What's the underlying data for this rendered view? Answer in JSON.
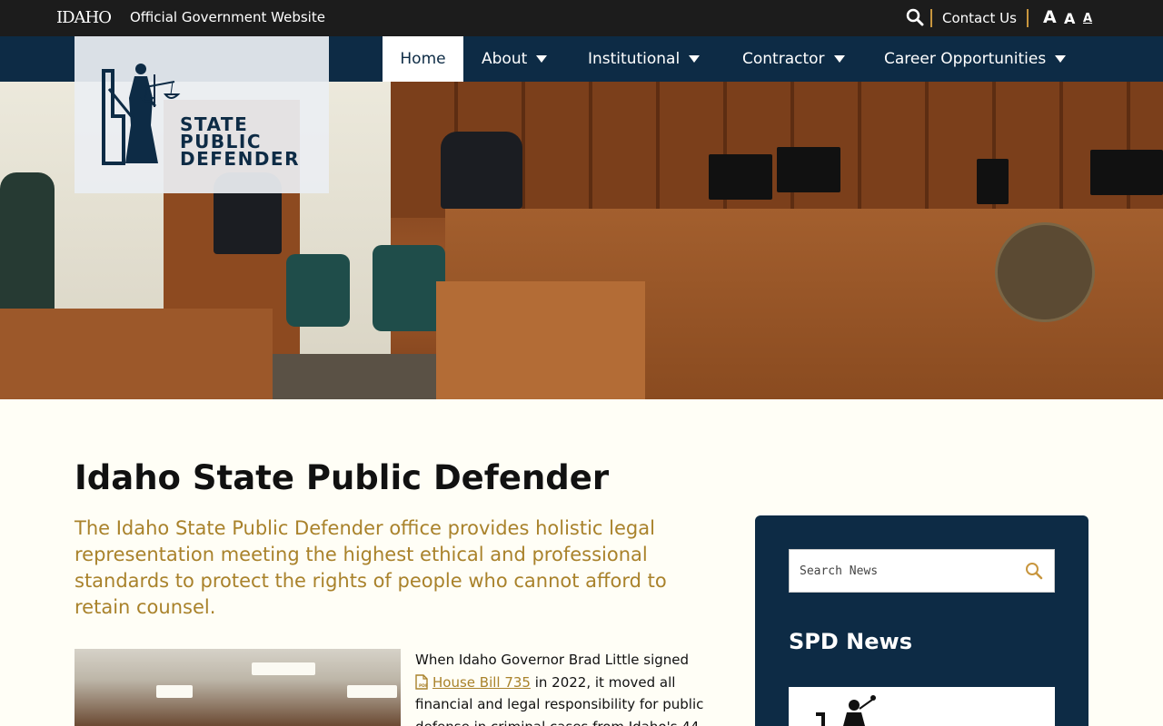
{
  "topbar": {
    "state_logo": "IDAHO",
    "official_label": "Official Government Website",
    "contact_label": "Contact Us",
    "font_sizes": [
      "A",
      "A",
      "A"
    ]
  },
  "nav": {
    "items": [
      {
        "label": "Home",
        "active": true
      },
      {
        "label": "About",
        "dropdown": true
      },
      {
        "label": "Institutional",
        "dropdown": true
      },
      {
        "label": "Contractor",
        "dropdown": true
      },
      {
        "label": "Career Opportunities",
        "dropdown": true
      }
    ]
  },
  "logo": {
    "line1": "STATE",
    "line2": "PUBLIC",
    "line3": "DEFENDER"
  },
  "main": {
    "title": "Idaho State Public Defender",
    "lead": "The Idaho State Public Defender office provides holistic legal representation meeting the highest ethical and professional standards to protect the rights of people who cannot afford to retain counsel.",
    "body_before_link": "When Idaho Governor Brad Little signed",
    "link_text": "House Bill 735",
    "body_after_link": " in 2022, it moved all financial and legal responsibility for public defense in criminal cases from Idaho's 44"
  },
  "sidebar": {
    "search_placeholder": "Search News",
    "title": "SPD News"
  },
  "colors": {
    "navy": "#0d2b45",
    "gold": "#a9822b",
    "topbar": "#1c1c1c",
    "background": "#fffef6"
  }
}
